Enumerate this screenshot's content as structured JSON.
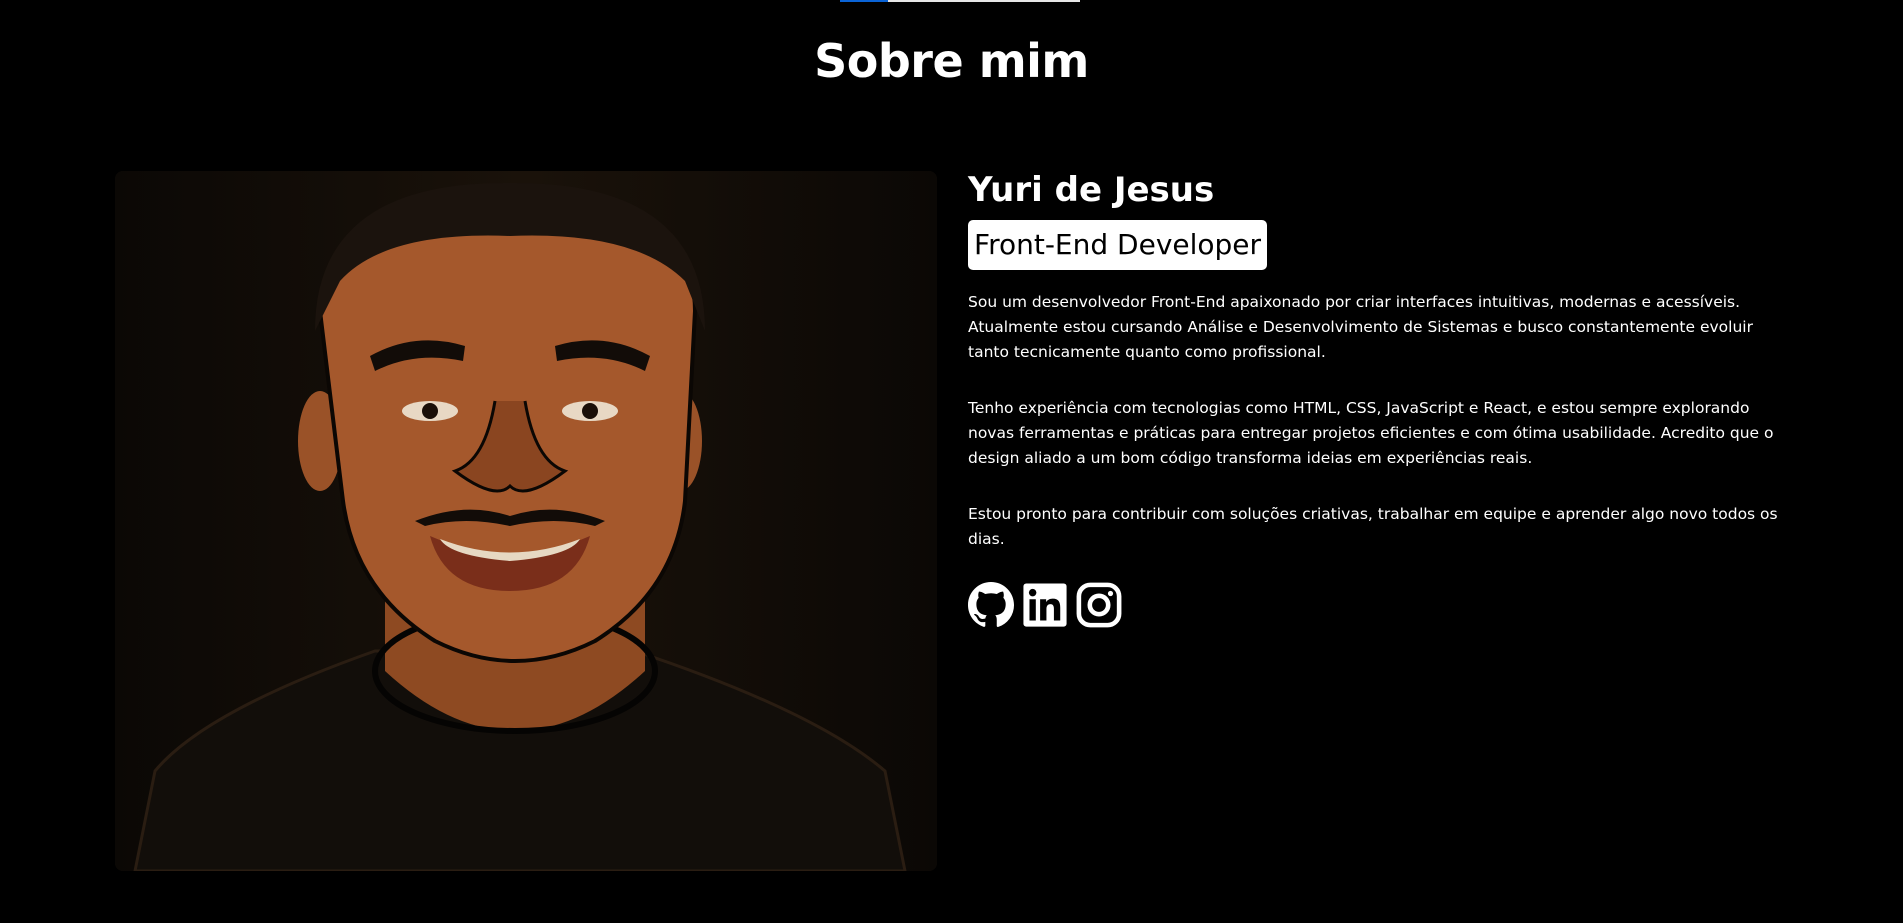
{
  "section_title": "Sobre mim",
  "progress_bar": {
    "value_percent": 20,
    "accent": "#0a63d6"
  },
  "profile": {
    "name": "Yuri de Jesus",
    "role": "Front-End Developer",
    "paragraphs": [
      "Sou um desenvolvedor Front-End apaixonado por criar interfaces intuitivas, modernas e acessíveis. Atualmente estou cursando Análise e Desenvolvimento de Sistemas e busco constantemente evoluir tanto tecnicamente quanto como profissional.",
      "Tenho experiência com tecnologias como HTML, CSS, JavaScript e React, e estou sempre explorando novas ferramentas e práticas para entregar projetos eficientes e com ótima usabilidade. Acredito que o design aliado a um bom código transforma ideias em experiências reais.",
      "Estou pronto para contribuir com soluções criativas, trabalhar em equipe e aprender algo novo todos os dias."
    ]
  },
  "socials": [
    {
      "icon": "github-icon"
    },
    {
      "icon": "linkedin-icon"
    },
    {
      "icon": "instagram-icon"
    }
  ]
}
